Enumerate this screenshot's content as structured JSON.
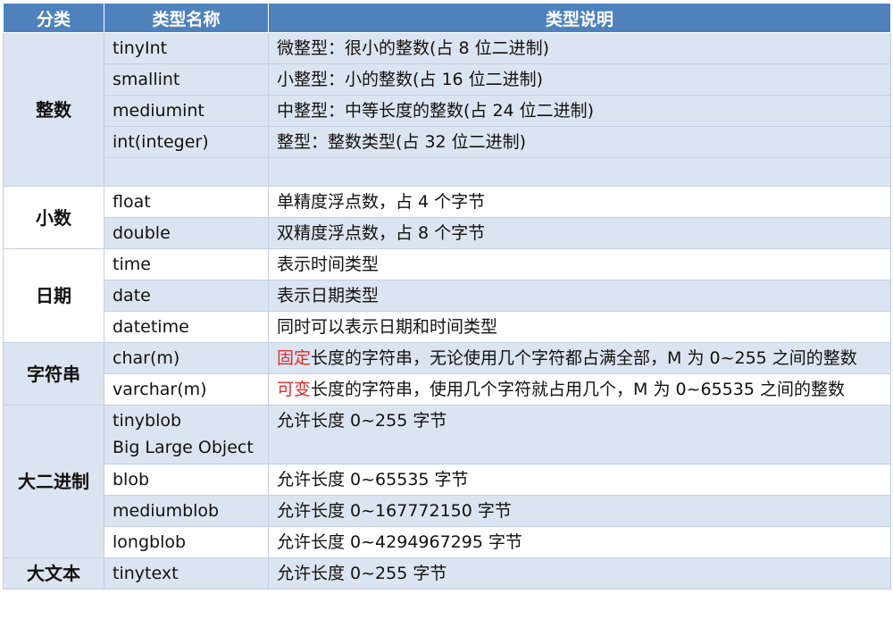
{
  "header": {
    "col_category": "分类",
    "col_type_name": "类型名称",
    "col_type_desc": "类型说明"
  },
  "categories": {
    "integer": "整数",
    "decimal": "小数",
    "date": "日期",
    "string": "字符串",
    "binary": "大二进制",
    "text": "大文本"
  },
  "rows": [
    {
      "name": "tinyInt",
      "desc": "微整型：很小的整数(占 8 位二进制)"
    },
    {
      "name": "smallint",
      "desc": "小整型：小的整数(占 16 位二进制)"
    },
    {
      "name": "mediumint",
      "desc": "中整型：中等长度的整数(占 24 位二进制)"
    },
    {
      "name": "int(integer)",
      "desc": "整型：整数类型(占 32 位二进制)"
    },
    {
      "name": "float",
      "desc": "单精度浮点数，占 4 个字节"
    },
    {
      "name": "double",
      "desc": "双精度浮点数，占 8 个字节"
    },
    {
      "name": "time",
      "desc": "表示时间类型"
    },
    {
      "name": "date",
      "desc": "表示日期类型"
    },
    {
      "name": "datetime",
      "desc": "同时可以表示日期和时间类型"
    },
    {
      "name": "char(m)",
      "desc_highlight": "固定",
      "desc": "长度的字符串，无论使用几个字符都占满全部，M 为 0~255 之间的整数"
    },
    {
      "name": "varchar(m)",
      "desc_highlight": "可变",
      "desc": "长度的字符串，使用几个字符就占用几个，M 为 0~65535 之间的整数"
    },
    {
      "name": "tinyblob",
      "name_line2": "Big Large Object",
      "desc": "允许长度 0~255 字节"
    },
    {
      "name": "blob",
      "desc": "允许长度 0~65535 字节"
    },
    {
      "name": "mediumblob",
      "desc": "允许长度 0~167772150 字节"
    },
    {
      "name": "longblob",
      "desc": "允许长度 0~4294967295 字节"
    },
    {
      "name": "tinytext",
      "desc": "允许长度 0~255 字节"
    }
  ],
  "colors": {
    "header_bg": "#4f81bd",
    "row_alt_bg": "#dbe5f1",
    "highlight_red": "#e02b2b"
  }
}
